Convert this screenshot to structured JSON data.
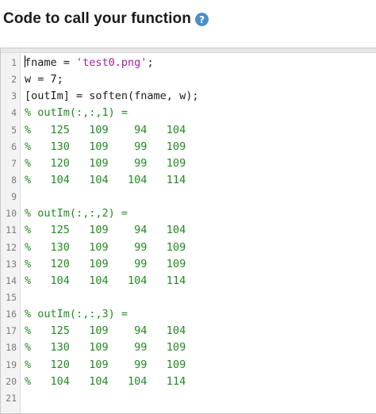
{
  "header": {
    "title": "Code to call your function",
    "help_icon": "help-icon",
    "help_glyph": "?",
    "help_color": "#4a90c8"
  },
  "colors": {
    "comment": "#228b22",
    "string": "#a31fa3",
    "text": "#1a1a1a",
    "line_number": "#7a7a7a"
  },
  "editor": {
    "lines": [
      {
        "number": "1",
        "segments": [
          {
            "t": "fname = ",
            "c": "plain"
          },
          {
            "t": "'test0.png'",
            "c": "string"
          },
          {
            "t": ";",
            "c": "plain"
          }
        ]
      },
      {
        "number": "2",
        "segments": [
          {
            "t": "w = 7;",
            "c": "plain"
          }
        ]
      },
      {
        "number": "3",
        "segments": [
          {
            "t": "[outIm] = soften(fname, w);",
            "c": "plain"
          }
        ]
      },
      {
        "number": "4",
        "segments": [
          {
            "t": "% outIm(:,:,1) =",
            "c": "comment"
          }
        ]
      },
      {
        "number": "5",
        "segments": [
          {
            "t": "%   125   109    94   104",
            "c": "comment"
          }
        ]
      },
      {
        "number": "6",
        "segments": [
          {
            "t": "%   130   109    99   109",
            "c": "comment"
          }
        ]
      },
      {
        "number": "7",
        "segments": [
          {
            "t": "%   120   109    99   109",
            "c": "comment"
          }
        ]
      },
      {
        "number": "8",
        "segments": [
          {
            "t": "%   104   104   104   114",
            "c": "comment"
          }
        ]
      },
      {
        "number": "9",
        "segments": []
      },
      {
        "number": "10",
        "segments": [
          {
            "t": "% outIm(:,:,2) =",
            "c": "comment"
          }
        ]
      },
      {
        "number": "11",
        "segments": [
          {
            "t": "%   125   109    94   104",
            "c": "comment"
          }
        ]
      },
      {
        "number": "12",
        "segments": [
          {
            "t": "%   130   109    99   109",
            "c": "comment"
          }
        ]
      },
      {
        "number": "13",
        "segments": [
          {
            "t": "%   120   109    99   109",
            "c": "comment"
          }
        ]
      },
      {
        "number": "14",
        "segments": [
          {
            "t": "%   104   104   104   114",
            "c": "comment"
          }
        ]
      },
      {
        "number": "15",
        "segments": []
      },
      {
        "number": "16",
        "segments": [
          {
            "t": "% outIm(:,:,3) =",
            "c": "comment"
          }
        ]
      },
      {
        "number": "17",
        "segments": [
          {
            "t": "%   125   109    94   104",
            "c": "comment"
          }
        ]
      },
      {
        "number": "18",
        "segments": [
          {
            "t": "%   130   109    99   109",
            "c": "comment"
          }
        ]
      },
      {
        "number": "19",
        "segments": [
          {
            "t": "%   120   109    99   109",
            "c": "comment"
          }
        ]
      },
      {
        "number": "20",
        "segments": [
          {
            "t": "%   104   104   104   114",
            "c": "comment"
          }
        ]
      },
      {
        "number": "21",
        "segments": []
      }
    ]
  }
}
